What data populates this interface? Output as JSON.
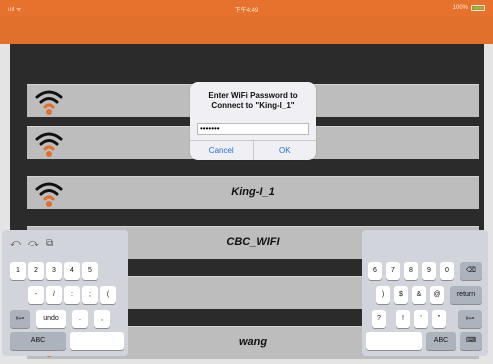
{
  "statusbar": {
    "left": "ıııl ᯤ",
    "time": "下午4:49",
    "battery": "100%"
  },
  "dialog": {
    "title_line1": "Enter WiFi Password to",
    "title_line2": "Connect to \"King-I_1\"",
    "password_value": "•••••••",
    "cancel": "Cancel",
    "ok": "OK"
  },
  "networks": [
    {
      "name": ""
    },
    {
      "name": ""
    },
    {
      "name": "King-I_1"
    },
    {
      "name": "CBC_WIFI"
    },
    {
      "name": ""
    },
    {
      "name": "wang"
    }
  ],
  "keyboard_left": {
    "toolbar": [
      "⤺",
      "⤼",
      "⧉"
    ],
    "row1": [
      "1",
      "2",
      "3",
      "4",
      "5"
    ],
    "row2": [
      "-",
      "/",
      ":",
      ";",
      "("
    ],
    "row3": [
      "#+=",
      "undo",
      ".",
      ","
    ],
    "row4": [
      "ABC"
    ]
  },
  "keyboard_right": {
    "row1": [
      "6",
      "7",
      "8",
      "9",
      "0",
      "⌫"
    ],
    "row2": [
      ")",
      "$",
      "&",
      "@",
      "return"
    ],
    "row3": [
      "?",
      "!",
      "'",
      "\"",
      "#+="
    ],
    "row4": [
      "ABC",
      "⌨"
    ]
  },
  "colors": {
    "orange": "#e2702d",
    "wifi_orange": "#e2702d",
    "link_blue": "#1a73e8"
  }
}
